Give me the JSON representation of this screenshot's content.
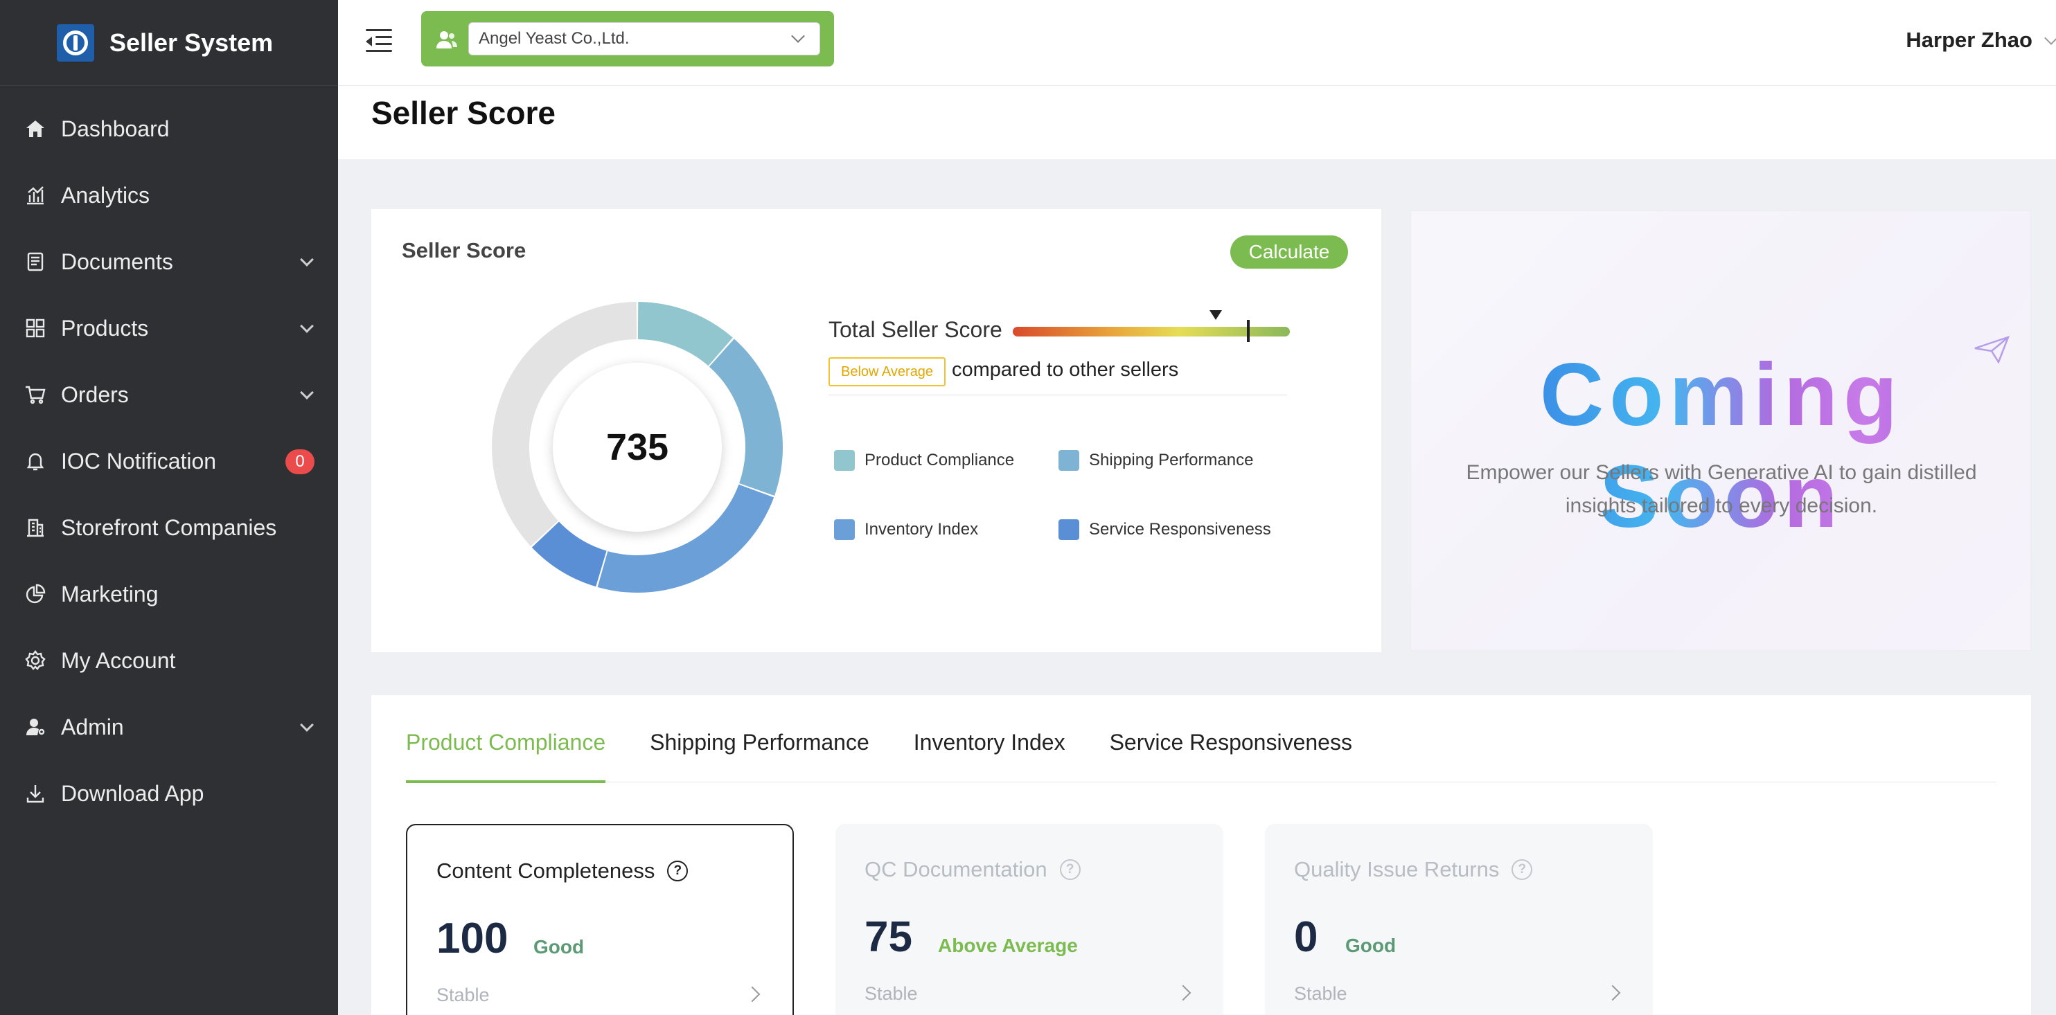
{
  "app": {
    "title": "Seller System"
  },
  "sidebar": {
    "items": [
      {
        "label": "Dashboard",
        "icon": "home-icon"
      },
      {
        "label": "Analytics",
        "icon": "analytics-icon"
      },
      {
        "label": "Documents",
        "icon": "documents-icon",
        "expandable": true
      },
      {
        "label": "Products",
        "icon": "grid-icon",
        "expandable": true
      },
      {
        "label": "Orders",
        "icon": "cart-icon",
        "expandable": true
      },
      {
        "label": "IOC Notification",
        "icon": "bell-icon",
        "badge": "0"
      },
      {
        "label": "Storefront Companies",
        "icon": "building-icon"
      },
      {
        "label": "Marketing",
        "icon": "pie-icon"
      },
      {
        "label": "My Account",
        "icon": "gear-icon"
      },
      {
        "label": "Admin",
        "icon": "user-icon",
        "expandable": true
      },
      {
        "label": "Download App",
        "icon": "download-icon"
      }
    ]
  },
  "header": {
    "company": "Angel Yeast Co.,Ltd.",
    "user": "Harper Zhao"
  },
  "page": {
    "title": "Seller Score"
  },
  "score_card": {
    "title": "Seller Score",
    "calculate_label": "Calculate",
    "score": "735",
    "total_label": "Total Seller Score",
    "rank_tag": "Below Average",
    "rank_text": "compared to other sellers",
    "legend": [
      {
        "label": "Product Compliance",
        "color": "#92c6cf"
      },
      {
        "label": "Shipping Performance",
        "color": "#7fb3d3"
      },
      {
        "label": "Inventory Index",
        "color": "#6a9fd8"
      },
      {
        "label": "Service Responsiveness",
        "color": "#5a8fd6"
      }
    ],
    "donut_segments": [
      {
        "name": "Product Compliance",
        "fraction": 0.115,
        "color": "#92c6cf"
      },
      {
        "name": "Shipping Performance",
        "fraction": 0.19,
        "color": "#7fb3d3"
      },
      {
        "name": "Inventory Index",
        "fraction": 0.24,
        "color": "#6a9fd8"
      },
      {
        "name": "Service Responsiveness",
        "fraction": 0.085,
        "color": "#5a8fd6"
      },
      {
        "name": "remaining",
        "fraction": 0.37,
        "color": "#e3e3e3"
      }
    ]
  },
  "coming_soon": {
    "title": "Coming Soon",
    "subtitle": "Empower our Sellers with Generative AI to gain distilled insights tailored to every decision."
  },
  "tabs": [
    {
      "label": "Product Compliance",
      "active": true
    },
    {
      "label": "Shipping Performance"
    },
    {
      "label": "Inventory Index"
    },
    {
      "label": "Service Responsiveness"
    }
  ],
  "metrics": [
    {
      "name": "Content Completeness",
      "value": "100",
      "grade": "Good",
      "trend": "Stable"
    },
    {
      "name": "QC Documentation",
      "value": "75",
      "grade": "Above Average",
      "trend": "Stable"
    },
    {
      "name": "Quality Issue Returns",
      "value": "0",
      "grade": "Good",
      "trend": "Stable"
    }
  ],
  "colors": {
    "accent": "#7cbb4f",
    "sidebar": "#2e3033",
    "badge": "#ec4b4b"
  }
}
